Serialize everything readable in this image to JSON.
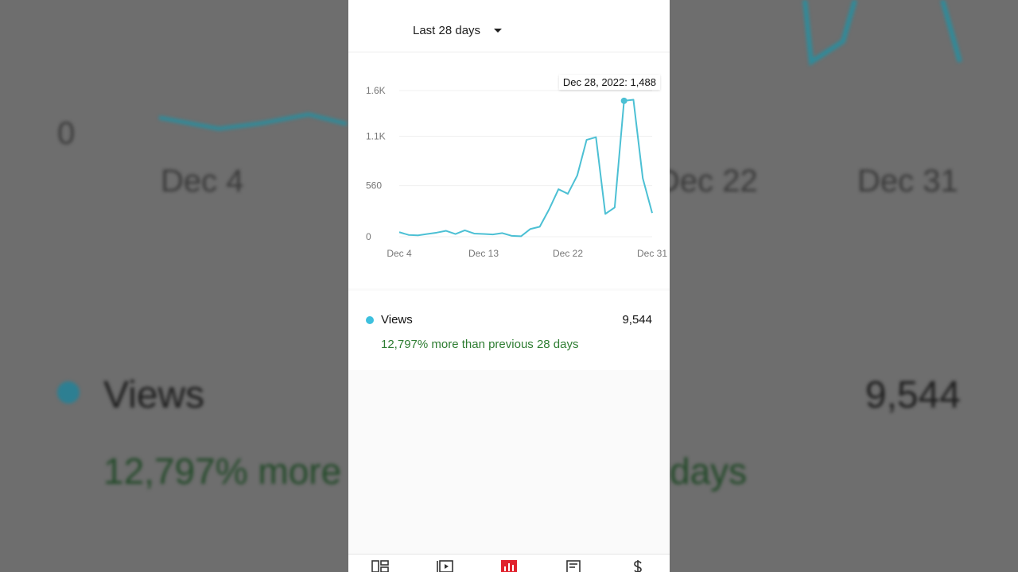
{
  "background": {
    "zero_tick": "0",
    "ticks": [
      "Dec 4",
      "Dec 22",
      "Dec 31"
    ],
    "metric_name": "Views",
    "metric_total": "9,544",
    "change_fragment_left": "12,797% more",
    "change_fragment_right": "days"
  },
  "header": {
    "range_label": "Last 28 days",
    "range_icon": "dropdown-caret-icon"
  },
  "chart": {
    "tooltip": "Dec 28, 2022: 1,488",
    "line_color": "#4cc0d4"
  },
  "chart_data": {
    "type": "line",
    "title": "",
    "xlabel": "",
    "ylabel": "",
    "y_ticks": [
      "0",
      "560",
      "1.1K",
      "1.6K"
    ],
    "y_tick_values": [
      0,
      560,
      1100,
      1600
    ],
    "ylim": [
      0,
      1600
    ],
    "x_ticks": [
      "Dec 4",
      "Dec 13",
      "Dec 22",
      "Dec 31"
    ],
    "x_tick_indices": [
      0,
      9,
      18,
      27
    ],
    "grid": true,
    "highlight_index": 24,
    "series": [
      {
        "name": "Views",
        "color": "#4cc0d4",
        "values": [
          50,
          20,
          15,
          30,
          45,
          65,
          30,
          70,
          35,
          30,
          25,
          40,
          10,
          5,
          85,
          110,
          300,
          520,
          470,
          670,
          1060,
          1090,
          250,
          320,
          1488,
          1500,
          640,
          260
        ]
      }
    ]
  },
  "metric": {
    "name": "Views",
    "value": "9,544",
    "change": "12,797% more than previous 28 days",
    "dot_color": "#3ec0de"
  },
  "nav": {
    "items": [
      {
        "icon": "dashboard-icon"
      },
      {
        "icon": "content-icon"
      },
      {
        "icon": "analytics-icon",
        "active": true,
        "active_color": "#e0222d"
      },
      {
        "icon": "comments-icon"
      },
      {
        "icon": "earn-icon"
      }
    ]
  }
}
